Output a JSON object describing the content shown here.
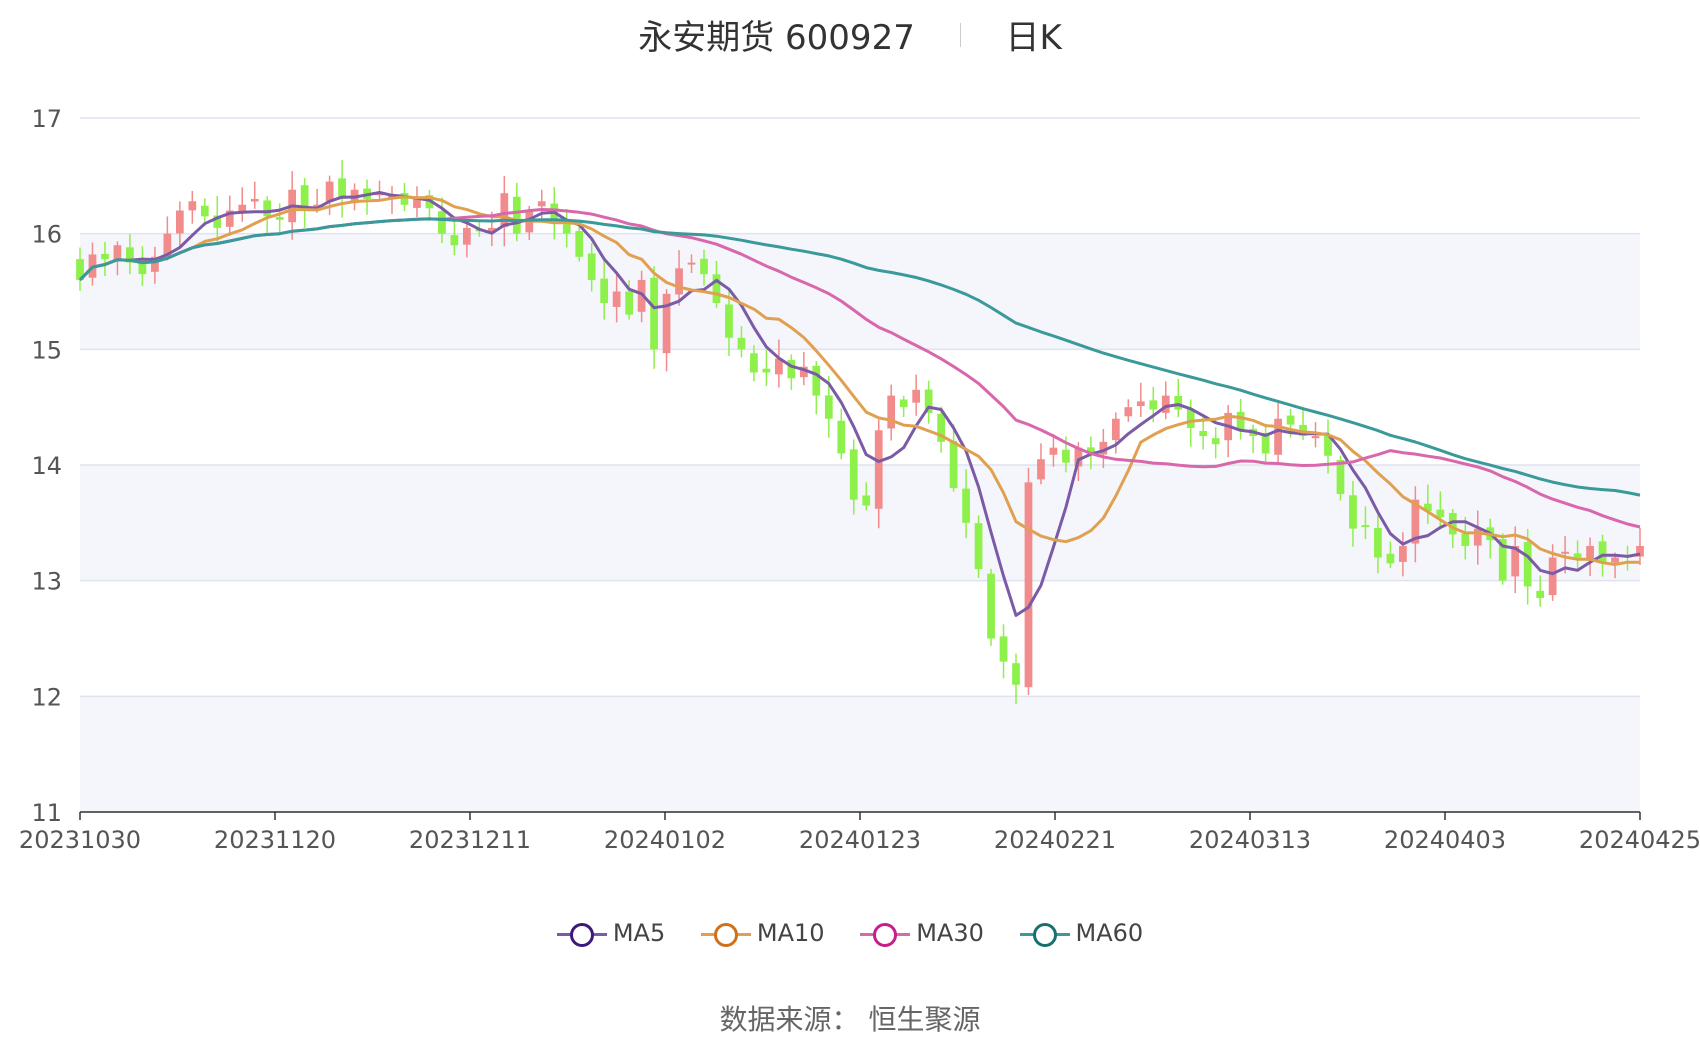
{
  "title": {
    "name": "永安期货 600927",
    "period": "日K"
  },
  "source": {
    "label": "数据来源：",
    "value": "恒生聚源"
  },
  "chart_data": {
    "type": "candlestick",
    "ylim": [
      11,
      17
    ],
    "y_ticks": [
      "17",
      "16",
      "15",
      "14",
      "13",
      "12",
      "11"
    ],
    "x_ticks": [
      "20231030",
      "20231120",
      "20231211",
      "20240102",
      "20240123",
      "20240221",
      "20240313",
      "20240403",
      "20240425"
    ],
    "colors": {
      "up": "#f28b8b",
      "down": "#8ef04a",
      "MA5": "#7b5aa6",
      "MA10": "#e0a050",
      "MA30": "#d867ab",
      "MA60": "#3a9a9a",
      "legend_MA5": "#3d1a78",
      "legend_MA10": "#d0701a",
      "legend_MA30": "#c41f8a",
      "legend_MA60": "#1a6f6f"
    },
    "grid": true,
    "legend": [
      "MA5",
      "MA10",
      "MA30",
      "MA60"
    ],
    "closes": [
      15.6,
      15.82,
      15.78,
      15.9,
      15.75,
      15.65,
      15.8,
      16.0,
      16.2,
      16.28,
      16.15,
      16.05,
      16.2,
      16.25,
      16.3,
      16.15,
      16.12,
      16.38,
      16.2,
      16.25,
      16.45,
      16.3,
      16.38,
      16.3,
      16.35,
      16.33,
      16.25,
      16.3,
      16.22,
      16.0,
      15.9,
      16.05,
      16.02,
      16.05,
      16.35,
      16.0,
      16.2,
      16.28,
      16.1,
      16.0,
      15.8,
      15.6,
      15.4,
      15.5,
      15.3,
      15.6,
      15.0,
      15.48,
      15.7,
      15.75,
      15.65,
      15.4,
      15.1,
      15.0,
      14.8,
      14.8,
      14.92,
      14.75,
      14.85,
      14.6,
      14.4,
      14.1,
      13.7,
      13.65,
      14.3,
      14.6,
      14.5,
      14.65,
      14.45,
      14.2,
      13.8,
      13.5,
      13.1,
      12.5,
      12.3,
      12.1,
      13.85,
      14.05,
      14.15,
      14.02,
      14.15,
      14.1,
      14.2,
      14.4,
      14.5,
      14.55,
      14.48,
      14.6,
      14.48,
      14.32,
      14.25,
      14.18,
      14.45,
      14.3,
      14.25,
      14.1,
      14.4,
      14.35,
      14.25,
      14.25,
      14.08,
      13.75,
      13.45,
      13.48,
      13.2,
      13.15,
      13.3,
      13.7,
      13.6,
      13.55,
      13.4,
      13.3,
      13.45,
      13.35,
      13.0,
      13.3,
      12.95,
      12.85,
      13.2,
      13.25,
      13.2,
      13.3,
      13.15,
      13.2,
      13.2,
      13.3
    ]
  }
}
